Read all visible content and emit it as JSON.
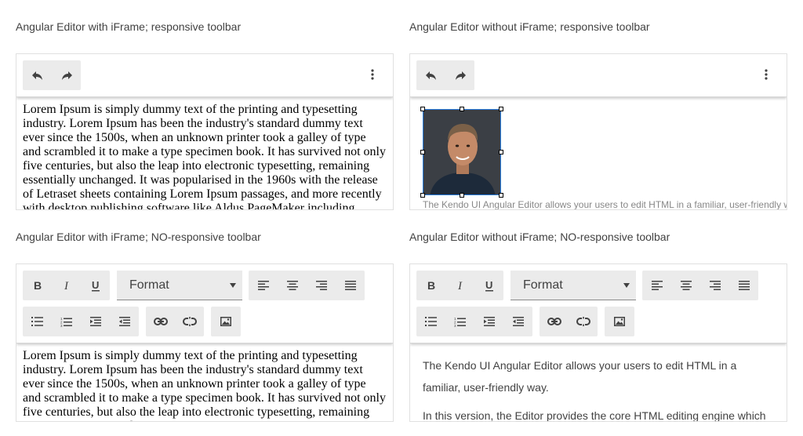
{
  "panels": {
    "tl": {
      "title": "Angular Editor with iFrame; responsive toolbar",
      "body": "Lorem Ipsum is simply dummy text of the printing and typesetting industry. Lorem Ipsum has been the industry's standard dummy text ever since the 1500s, when an unknown printer took a galley of type and scrambled it to make a type specimen book. It has survived not only five centuries, but also the leap into electronic typesetting, remaining essentially unchanged. It was popularised in the 1960s with the release of Letraset sheets containing Lorem Ipsum passages, and more recently with desktop publishing software like Aldus PageMaker including"
    },
    "tr": {
      "title": "Angular Editor without iFrame; responsive toolbar",
      "body": "The Kendo UI Angular Editor allows your users to edit HTML in a familiar, user-friendly way."
    },
    "bl": {
      "title": "Angular Editor with iFrame; NO-responsive toolbar",
      "format_label": "Format",
      "body": "Lorem Ipsum is simply dummy text of the printing and typesetting industry. Lorem Ipsum has been the industry's standard dummy text ever since the 1500s, when an unknown printer took a galley of type and scrambled it to make a type specimen book. It has survived not only five centuries, but also the leap into electronic typesetting, remaining essentially unchanged."
    },
    "br": {
      "title": "Angular Editor without iFrame; NO-responsive toolbar",
      "format_label": "Format",
      "paragraph1": "The Kendo UI Angular Editor allows your users to edit HTML in a familiar, user-friendly way.",
      "paragraph2": "In this version, the Editor provides the core HTML editing engine which"
    }
  },
  "icons": {
    "undo": "undo-icon",
    "redo": "redo-icon",
    "more": "more-vertical-icon",
    "bold": "bold-icon",
    "italic": "italic-icon",
    "underline": "underline-icon",
    "align_left": "align-left-icon",
    "align_center": "align-center-icon",
    "align_right": "align-right-icon",
    "align_justify": "align-justify-icon",
    "bullets": "bulleted-list-icon",
    "numbers": "numbered-list-icon",
    "indent": "indent-icon",
    "outdent": "outdent-icon",
    "link": "link-icon",
    "unlink": "unlink-icon",
    "image": "image-icon"
  },
  "colors": {
    "toolbar_group_bg": "#ebebeb",
    "selection_border": "#2a7de1",
    "text": "#424242"
  }
}
